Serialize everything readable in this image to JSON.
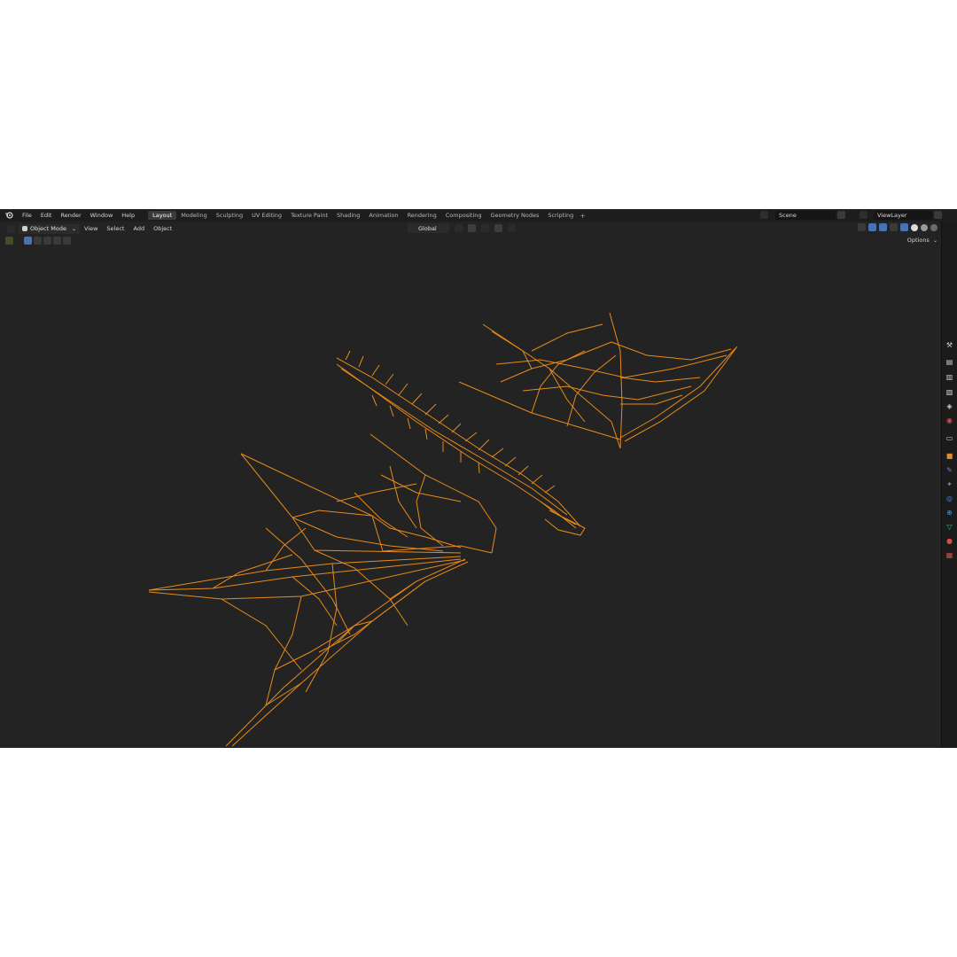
{
  "menus": [
    "File",
    "Edit",
    "Render",
    "Window",
    "Help"
  ],
  "workspace_tabs": [
    {
      "label": "Layout",
      "active": true
    },
    {
      "label": "Modeling",
      "active": false
    },
    {
      "label": "Sculpting",
      "active": false
    },
    {
      "label": "UV Editing",
      "active": false
    },
    {
      "label": "Texture Paint",
      "active": false
    },
    {
      "label": "Shading",
      "active": false
    },
    {
      "label": "Animation",
      "active": false
    },
    {
      "label": "Rendering",
      "active": false
    },
    {
      "label": "Compositing",
      "active": false
    },
    {
      "label": "Geometry Nodes",
      "active": false
    },
    {
      "label": "Scripting",
      "active": false
    }
  ],
  "add_tab_label": "+",
  "scene": {
    "name": "Scene"
  },
  "view_layer": {
    "name": "ViewLayer"
  },
  "viewport_header": {
    "mode": "Object Mode",
    "menus": [
      "View",
      "Select",
      "Add",
      "Object"
    ],
    "transform_orientation": "Global",
    "options_label": "Options"
  },
  "icons": [
    "blender-logo-icon",
    "editor-type-icon",
    "object-mode-icon",
    "snap-icon",
    "proportional-edit-icon",
    "overlay-icon",
    "xray-icon",
    "shading-solid-icon",
    "tool-icon",
    "render-icon",
    "output-icon",
    "view-layer-icon",
    "scene-icon",
    "world-icon",
    "collection-icon",
    "object-icon",
    "modifier-icon",
    "particles-icon",
    "physics-icon",
    "constraints-icon",
    "data-icon",
    "material-icon",
    "texture-icon"
  ],
  "colors": {
    "wireframe": "#e88a1a",
    "background": "#232323",
    "active_tab": "#3a3a3a",
    "accent_blue": "#4772b3"
  }
}
